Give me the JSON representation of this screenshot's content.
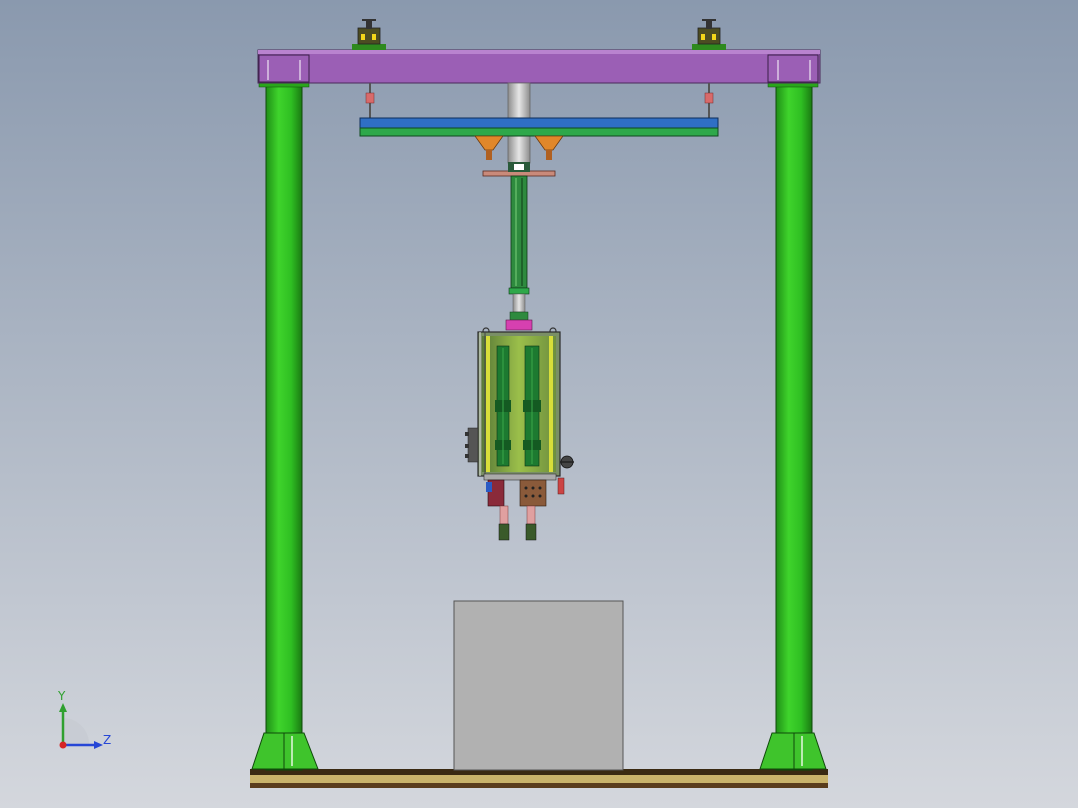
{
  "colors": {
    "bg_top": "#8c9bb0",
    "bg_bottom": "#cfd3da",
    "column_green": "#33cc22",
    "column_green_dark": "#1e8a14",
    "beam_purple": "#9b5fb5",
    "beam_purple_dark": "#6e3e86",
    "plate_blue": "#2f6fc4",
    "plate_green": "#2ea84a",
    "base_brown": "#5a3d1c",
    "base_yellow": "#c9b36a",
    "box_gray": "#b1b1b1",
    "axis_y": "#2fa02f",
    "axis_z": "#2646d6",
    "axis_origin": "#d62424"
  },
  "triad": {
    "y_label": "Y",
    "z_label": "Z"
  }
}
